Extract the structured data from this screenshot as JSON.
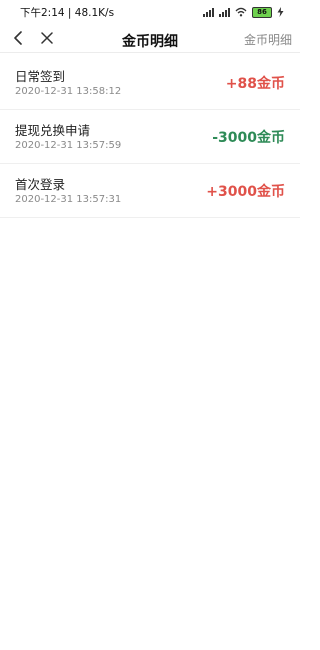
{
  "status_bar": {
    "time_speed": "下午2:14 | 48.1K/s",
    "battery": "86"
  },
  "nav": {
    "title": "金币明细",
    "right_label": "金币明细",
    "back_icon": "chevron-left-icon",
    "close_icon": "close-icon"
  },
  "colors": {
    "positive": "#e0524a",
    "negative": "#2e8b57"
  },
  "records": [
    {
      "title": "日常签到",
      "time": "2020-12-31 13:58:12",
      "amount": "+88金币",
      "type": "positive"
    },
    {
      "title": "提现兑换申请",
      "time": "2020-12-31 13:57:59",
      "amount": "-3000金币",
      "type": "negative"
    },
    {
      "title": "首次登录",
      "time": "2020-12-31 13:57:31",
      "amount": "+3000金币",
      "type": "positive"
    }
  ]
}
